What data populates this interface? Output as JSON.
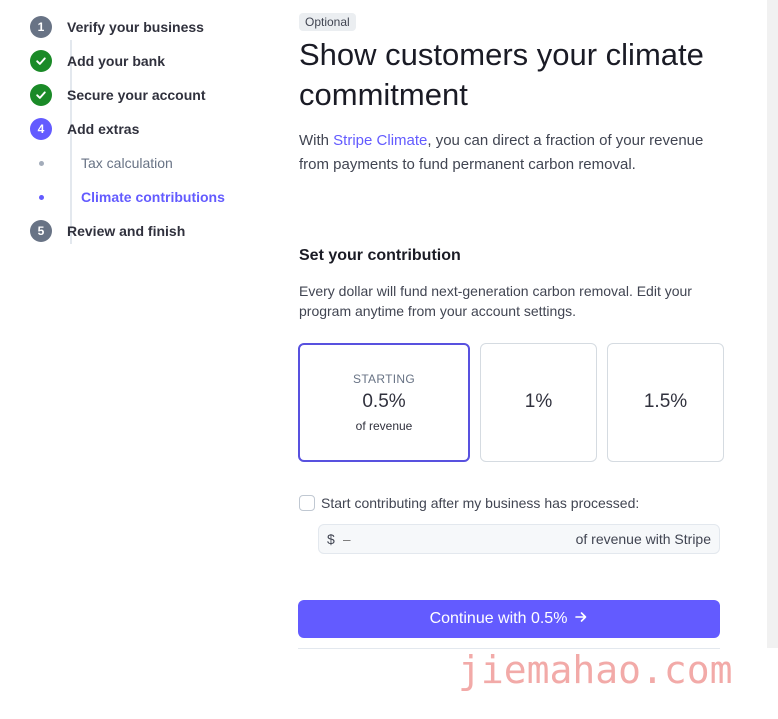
{
  "sidebar": {
    "steps": [
      {
        "num": "1",
        "label": "Verify your business",
        "state": "pending"
      },
      {
        "num": "",
        "label": "Add your bank",
        "state": "done"
      },
      {
        "num": "",
        "label": "Secure your account",
        "state": "done"
      },
      {
        "num": "4",
        "label": "Add extras",
        "state": "current"
      },
      {
        "num": "",
        "label": "Tax calculation",
        "state": "substep"
      },
      {
        "num": "",
        "label": "Climate contributions",
        "state": "substep-active"
      },
      {
        "num": "5",
        "label": "Review and finish",
        "state": "pending"
      }
    ]
  },
  "main": {
    "badge": "Optional",
    "title": "Show customers your climate commitment",
    "intro_prefix": "With ",
    "intro_link": "Stripe Climate",
    "intro_suffix": ", you can direct a fraction of your revenue from payments to fund permanent carbon removal.",
    "section_title": "Set your contribution",
    "section_desc": "Every dollar will fund next-generation carbon removal. Edit your program anytime from your account settings.",
    "options": [
      {
        "tag": "STARTING",
        "value": "0.5%",
        "sub": "of revenue",
        "selected": true
      },
      {
        "tag": "",
        "value": "1%",
        "sub": "",
        "selected": false
      },
      {
        "tag": "",
        "value": "1.5%",
        "sub": "",
        "selected": false
      }
    ],
    "threshold_label": "Start contributing after my business has processed:",
    "amount": {
      "currency": "$",
      "placeholder": "–",
      "suffix": "of revenue with Stripe"
    },
    "continue_label": "Continue with 0.5%",
    "continue_icon": "arrow-right-icon"
  },
  "watermark": "jiemahao.com",
  "colors": {
    "accent": "#635bff",
    "success": "#1a8a27",
    "muted": "#687385"
  }
}
